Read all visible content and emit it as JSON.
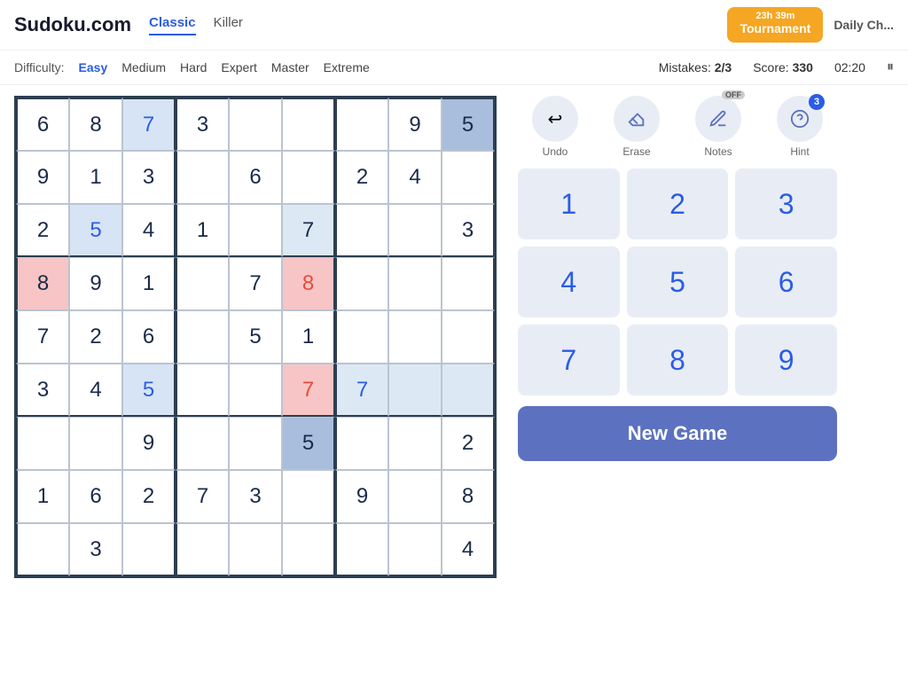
{
  "header": {
    "logo": "Sudoku.com",
    "tabs": [
      {
        "label": "Classic",
        "active": true
      },
      {
        "label": "Killer",
        "active": false
      }
    ],
    "tournament": {
      "timer": "23h 39m",
      "label": "Tournament"
    },
    "daily_ch": "Daily Ch..."
  },
  "difficulty": {
    "label": "Difficulty:",
    "options": [
      "Easy",
      "Medium",
      "Hard",
      "Expert",
      "Master",
      "Extreme"
    ],
    "selected": "Easy"
  },
  "stats": {
    "mistakes_label": "Mistakes:",
    "mistakes_value": "2/3",
    "score_label": "Score:",
    "score_value": "330",
    "time": "02:20"
  },
  "tools": [
    {
      "id": "undo",
      "label": "Undo",
      "icon": "↩",
      "badge": null,
      "off": false
    },
    {
      "id": "erase",
      "label": "Erase",
      "icon": "✏",
      "badge": null,
      "off": false
    },
    {
      "id": "notes",
      "label": "Notes",
      "icon": "📝",
      "badge": null,
      "off": true
    },
    {
      "id": "hint",
      "label": "Hint",
      "icon": "💡",
      "badge": "3",
      "off": false
    }
  ],
  "numpad": [
    "1",
    "2",
    "3",
    "4",
    "5",
    "6",
    "7",
    "8",
    "9"
  ],
  "new_game_label": "New Game",
  "grid": [
    [
      {
        "v": "6",
        "t": "given",
        "bg": ""
      },
      {
        "v": "8",
        "t": "given",
        "bg": ""
      },
      {
        "v": "7",
        "t": "user",
        "bg": "bg-blue"
      },
      {
        "v": "3",
        "t": "given",
        "bg": ""
      },
      {
        "v": "",
        "t": "",
        "bg": ""
      },
      {
        "v": "",
        "t": "",
        "bg": ""
      },
      {
        "v": "",
        "t": "",
        "bg": ""
      },
      {
        "v": "9",
        "t": "given",
        "bg": ""
      },
      {
        "v": "5",
        "t": "given",
        "bg": "bg-dark-blue"
      }
    ],
    [
      {
        "v": "9",
        "t": "given",
        "bg": ""
      },
      {
        "v": "1",
        "t": "given",
        "bg": ""
      },
      {
        "v": "3",
        "t": "given",
        "bg": ""
      },
      {
        "v": "",
        "t": "",
        "bg": ""
      },
      {
        "v": "6",
        "t": "given",
        "bg": ""
      },
      {
        "v": "",
        "t": "",
        "bg": ""
      },
      {
        "v": "2",
        "t": "given",
        "bg": ""
      },
      {
        "v": "4",
        "t": "given",
        "bg": ""
      },
      {
        "v": "",
        "t": "",
        "bg": ""
      }
    ],
    [
      {
        "v": "2",
        "t": "given",
        "bg": ""
      },
      {
        "v": "5",
        "t": "user",
        "bg": "bg-blue"
      },
      {
        "v": "4",
        "t": "given",
        "bg": ""
      },
      {
        "v": "1",
        "t": "given",
        "bg": ""
      },
      {
        "v": "",
        "t": "",
        "bg": ""
      },
      {
        "v": "7",
        "t": "given",
        "bg": "bg-blue-light"
      },
      {
        "v": "",
        "t": "",
        "bg": ""
      },
      {
        "v": "",
        "t": "",
        "bg": ""
      },
      {
        "v": "3",
        "t": "given",
        "bg": ""
      }
    ],
    [
      {
        "v": "8",
        "t": "given",
        "bg": "bg-pink"
      },
      {
        "v": "9",
        "t": "given",
        "bg": ""
      },
      {
        "v": "1",
        "t": "given",
        "bg": ""
      },
      {
        "v": "",
        "t": "",
        "bg": ""
      },
      {
        "v": "7",
        "t": "given",
        "bg": ""
      },
      {
        "v": "8",
        "t": "error",
        "bg": "bg-pink"
      },
      {
        "v": "",
        "t": "",
        "bg": ""
      },
      {
        "v": "",
        "t": "",
        "bg": ""
      },
      {
        "v": "",
        "t": "",
        "bg": ""
      }
    ],
    [
      {
        "v": "7",
        "t": "given",
        "bg": ""
      },
      {
        "v": "2",
        "t": "given",
        "bg": ""
      },
      {
        "v": "6",
        "t": "given",
        "bg": ""
      },
      {
        "v": "",
        "t": "",
        "bg": ""
      },
      {
        "v": "5",
        "t": "given",
        "bg": ""
      },
      {
        "v": "1",
        "t": "given",
        "bg": ""
      },
      {
        "v": "",
        "t": "",
        "bg": ""
      },
      {
        "v": "",
        "t": "",
        "bg": ""
      },
      {
        "v": "",
        "t": "",
        "bg": ""
      }
    ],
    [
      {
        "v": "3",
        "t": "given",
        "bg": ""
      },
      {
        "v": "4",
        "t": "given",
        "bg": ""
      },
      {
        "v": "5",
        "t": "user",
        "bg": "bg-blue"
      },
      {
        "v": "",
        "t": "",
        "bg": ""
      },
      {
        "v": "",
        "t": "",
        "bg": ""
      },
      {
        "v": "7",
        "t": "error",
        "bg": "bg-pink"
      },
      {
        "v": "7",
        "t": "user",
        "bg": "bg-blue-light"
      },
      {
        "v": "",
        "t": "",
        "bg": "bg-blue-light"
      },
      {
        "v": "",
        "t": "",
        "bg": "bg-blue-light"
      }
    ],
    [
      {
        "v": "",
        "t": "",
        "bg": ""
      },
      {
        "v": "",
        "t": "",
        "bg": ""
      },
      {
        "v": "9",
        "t": "given",
        "bg": ""
      },
      {
        "v": "",
        "t": "",
        "bg": ""
      },
      {
        "v": "",
        "t": "",
        "bg": ""
      },
      {
        "v": "5",
        "t": "given",
        "bg": "bg-dark-blue"
      },
      {
        "v": "",
        "t": "",
        "bg": ""
      },
      {
        "v": "",
        "t": "",
        "bg": ""
      },
      {
        "v": "2",
        "t": "given",
        "bg": ""
      }
    ],
    [
      {
        "v": "1",
        "t": "given",
        "bg": ""
      },
      {
        "v": "6",
        "t": "given",
        "bg": ""
      },
      {
        "v": "2",
        "t": "given",
        "bg": ""
      },
      {
        "v": "7",
        "t": "given",
        "bg": ""
      },
      {
        "v": "3",
        "t": "given",
        "bg": ""
      },
      {
        "v": "",
        "t": "",
        "bg": ""
      },
      {
        "v": "9",
        "t": "given",
        "bg": ""
      },
      {
        "v": "",
        "t": "",
        "bg": ""
      },
      {
        "v": "8",
        "t": "given",
        "bg": ""
      }
    ],
    [
      {
        "v": "",
        "t": "",
        "bg": ""
      },
      {
        "v": "3",
        "t": "given",
        "bg": ""
      },
      {
        "v": "",
        "t": "",
        "bg": ""
      },
      {
        "v": "",
        "t": "",
        "bg": ""
      },
      {
        "v": "",
        "t": "",
        "bg": ""
      },
      {
        "v": "",
        "t": "",
        "bg": ""
      },
      {
        "v": "",
        "t": "",
        "bg": ""
      },
      {
        "v": "",
        "t": "",
        "bg": ""
      },
      {
        "v": "4",
        "t": "given",
        "bg": ""
      }
    ]
  ]
}
